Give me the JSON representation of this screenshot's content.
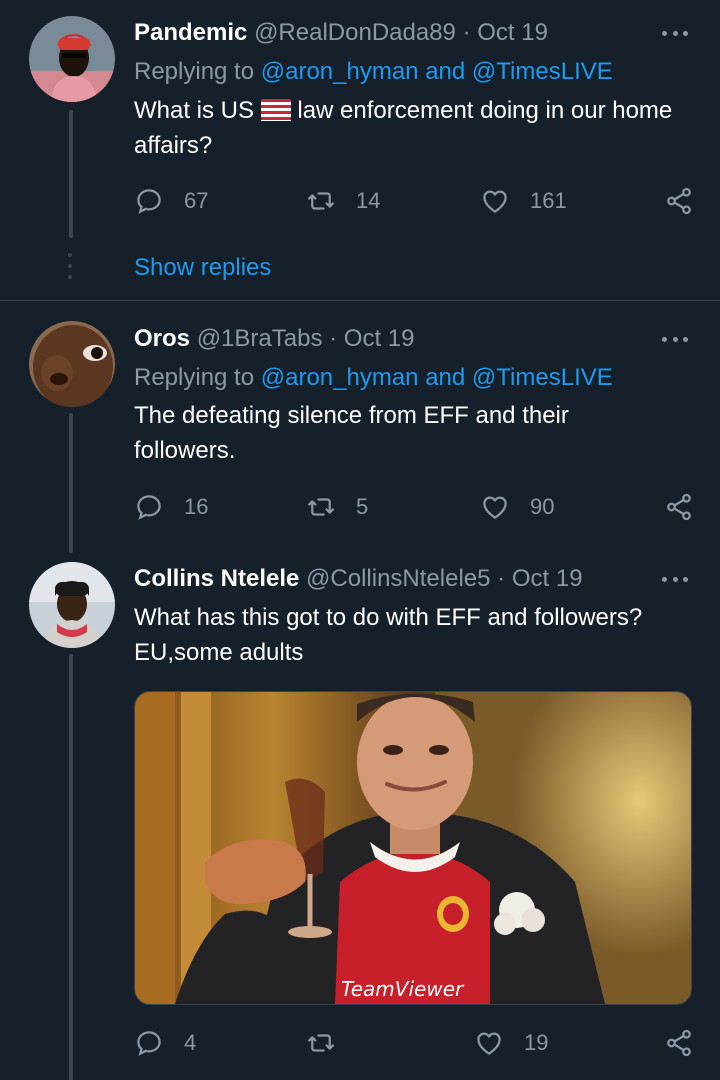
{
  "tweets": [
    {
      "name": "Pandemic",
      "handle": "@RealDonDada89",
      "date": "Oct 19",
      "replying_prefix": "Replying to",
      "replying_mention1": "@aron_hyman",
      "replying_and": "and",
      "replying_mention2": "@TimesLIVE",
      "text_before_flag": "What is US",
      "flag": "🇺🇸",
      "text_after_flag": "law enforcement doing in our home affairs?",
      "replies": "67",
      "retweets": "14",
      "likes": "161"
    },
    {
      "name": "Oros",
      "handle": "@1BraTabs",
      "date": "Oct 19",
      "replying_prefix": "Replying to",
      "replying_mention1": "@aron_hyman",
      "replying_and": "and",
      "replying_mention2": "@TimesLIVE",
      "text": "The defeating silence from EFF and their followers.",
      "replies": "16",
      "retweets": "5",
      "likes": "90"
    },
    {
      "name": "Collins Ntelele",
      "handle": "@CollinsNtelele5",
      "date": "Oct 19",
      "text_line1": "What has this got to do with EFF and followers?",
      "text_line2": "EU,some adults",
      "media_caption": "TeamViewer",
      "replies": "4",
      "retweets": "",
      "likes": "19"
    }
  ],
  "show_replies": "Show replies",
  "separator": "·",
  "colors": {
    "background": "#15202b",
    "accent": "#1d9bf0",
    "muted": "#8b98a5",
    "divider": "#38444d"
  },
  "icons": [
    "reply-icon",
    "retweet-icon",
    "like-icon",
    "share-icon",
    "more-icon"
  ]
}
